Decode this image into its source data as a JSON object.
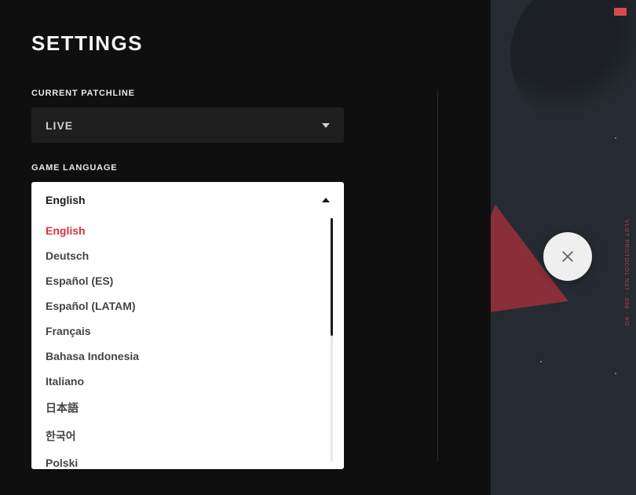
{
  "title": "SETTINGS",
  "patchline": {
    "label": "CURRENT PATCHLINE",
    "value": "LIVE"
  },
  "language": {
    "label": "GAME LANGUAGE",
    "selected": "English",
    "options": [
      "English",
      "Deutsch",
      "Español (ES)",
      "Español (LATAM)",
      "Français",
      "Bahasa Indonesia",
      "Italiano",
      "日本語",
      "한국어",
      "Polski"
    ]
  },
  "background": {
    "side_text": "VLGT PROTOCOL N37 - 098 - XO"
  },
  "icons": {
    "close": "close-icon",
    "caret_down": "caret-down-icon",
    "caret_up": "caret-up-icon"
  }
}
